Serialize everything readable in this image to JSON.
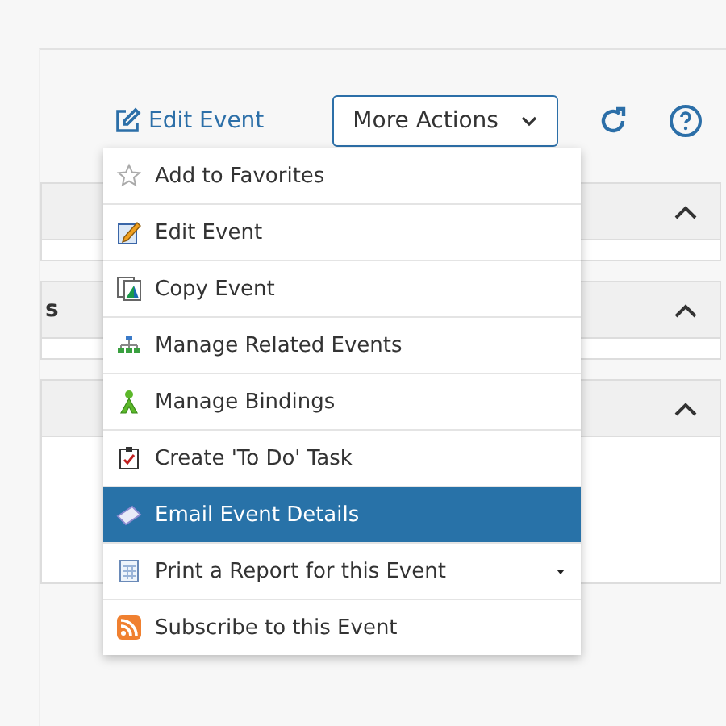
{
  "toolbar": {
    "edit_link": "Edit Event",
    "more_actions": "More Actions"
  },
  "sections": [
    {
      "expanded": true
    },
    {
      "title": "s",
      "expanded": true
    },
    {
      "expanded": true
    }
  ],
  "menu": [
    {
      "kind": "star",
      "label": "Add to Favorites",
      "selected": false,
      "submenu": false
    },
    {
      "kind": "pencil",
      "label": "Edit Event",
      "selected": false,
      "submenu": false
    },
    {
      "kind": "copy",
      "label": "Copy Event",
      "selected": false,
      "submenu": false
    },
    {
      "kind": "tree",
      "label": "Manage Related Events",
      "selected": false,
      "submenu": false
    },
    {
      "kind": "binding",
      "label": "Manage Bindings",
      "selected": false,
      "submenu": false
    },
    {
      "kind": "task",
      "label": "Create 'To Do' Task",
      "selected": false,
      "submenu": false
    },
    {
      "kind": "email",
      "label": "Email Event Details",
      "selected": true,
      "submenu": false
    },
    {
      "kind": "report",
      "label": "Print a Report for this Event",
      "selected": false,
      "submenu": true
    },
    {
      "kind": "rss",
      "label": "Subscribe to this Event",
      "selected": false,
      "submenu": false
    }
  ]
}
